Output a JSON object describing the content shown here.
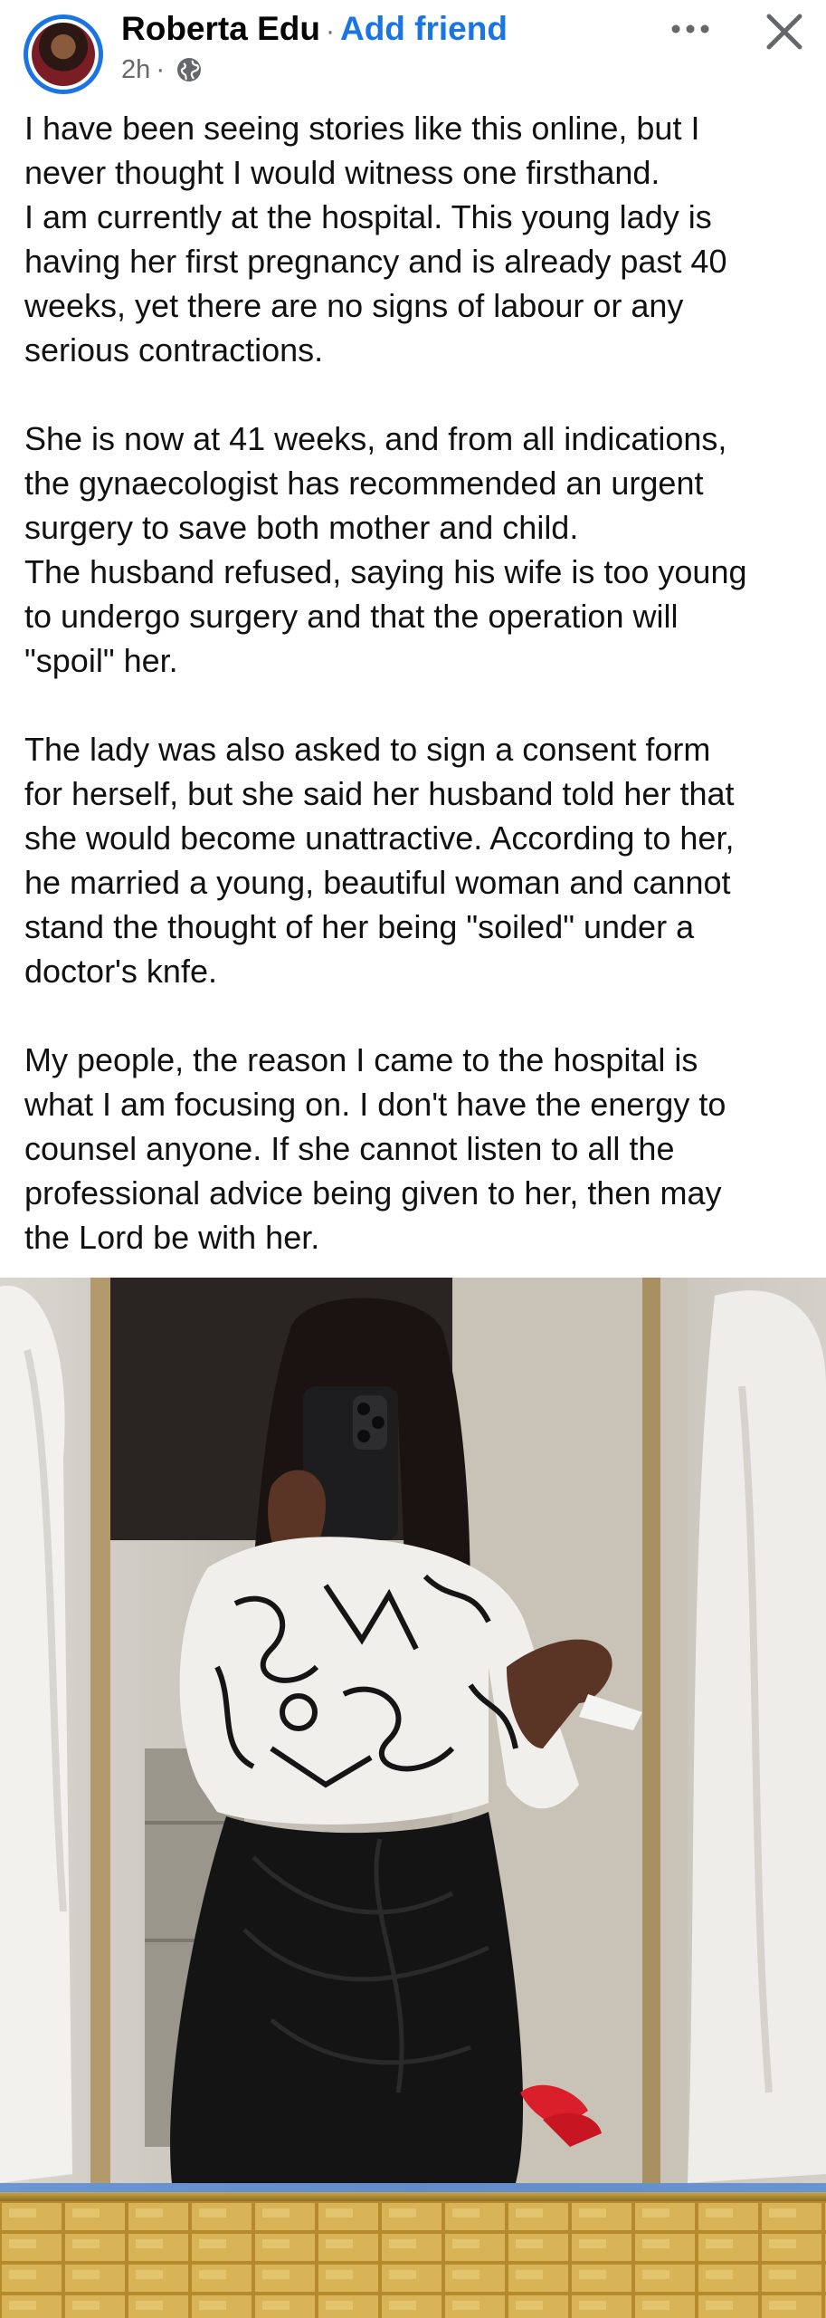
{
  "post": {
    "author_name": "Roberta Edu",
    "separator": "·",
    "add_friend_label": "Add friend",
    "time_ago": "2h",
    "meta_separator": "·",
    "audience_icon": "globe-icon",
    "more_icon": "more-options-icon",
    "close_icon": "close-icon"
  },
  "body": {
    "paragraphs": [
      {
        "lines": [
          "I have been seeing stories like this online, but I",
          "never thought I would witness one firsthand.",
          "I am currently at the hospital. This young lady is",
          "having her first pregnancy and is already past 40",
          "weeks, yet there are no signs of labour or any",
          "serious contractions."
        ]
      },
      {
        "lines": [
          "She is now at 41 weeks, and from all indications,",
          "the gynaecologist has recommended an urgent",
          "surgery to save both mother and child.",
          "The husband refused, saying his wife is too young",
          "to undergo surgery and that the operation will",
          "\"spoil\" her."
        ]
      },
      {
        "lines": [
          "The lady was also asked to sign a consent form",
          "for herself, but she said her husband told her that",
          "she would become unattractive. According to her,",
          "he married a young, beautiful woman and cannot",
          "stand the thought of her being \"soiled\" under a",
          "doctor's knfe."
        ]
      },
      {
        "lines": [
          "My people, the reason I came to the hospital is",
          "what I am focusing on. I don't have the energy to",
          "counsel anyone. If she cannot listen to all the",
          "professional advice being given to her, then may",
          "the Lord be with her."
        ]
      }
    ]
  },
  "colors": {
    "link_blue": "#1b74e4",
    "secondary_text": "#65676b",
    "primary_text": "#050505"
  }
}
